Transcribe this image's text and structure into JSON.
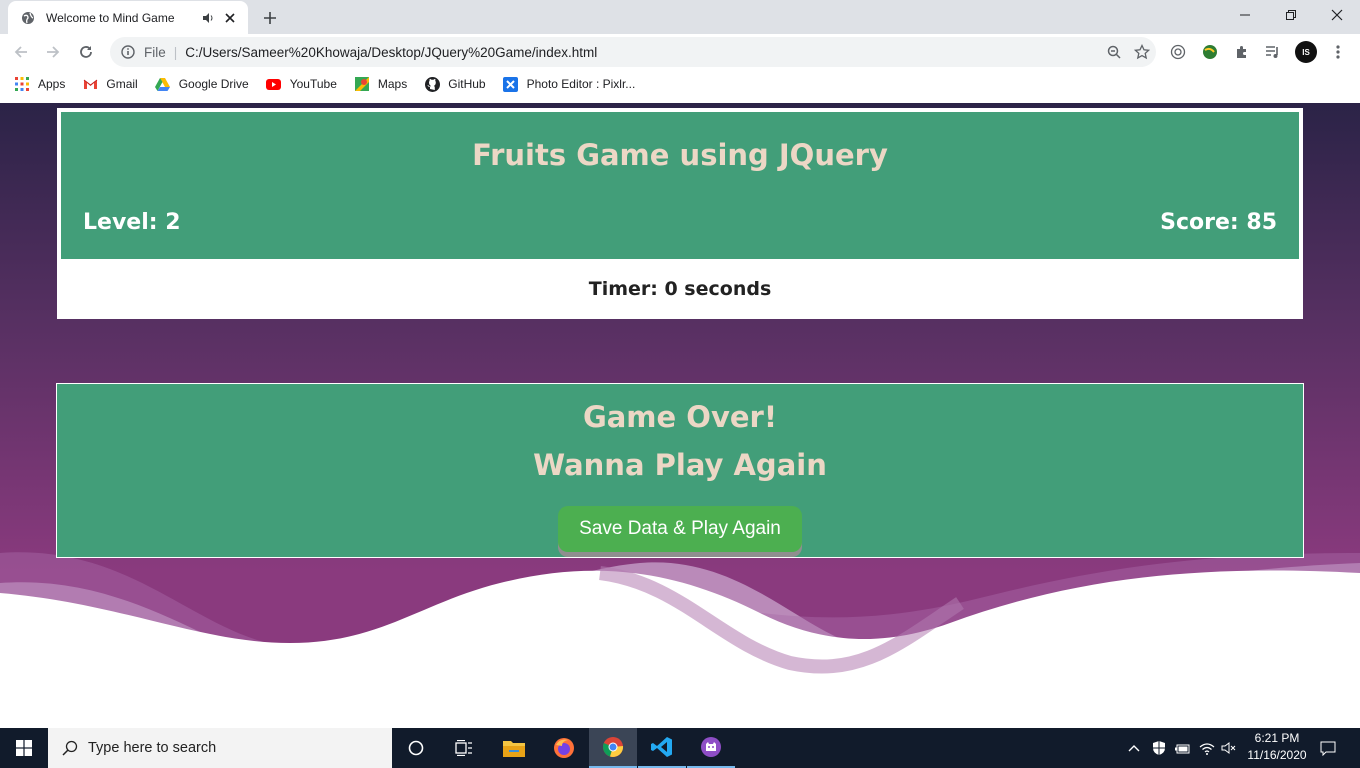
{
  "browser": {
    "tab_title": "Welcome to Mind Game",
    "url_scheme": "File",
    "url": "C:/Users/Sameer%20Khowaja/Desktop/JQuery%20Game/index.html",
    "bookmarks": [
      "Apps",
      "Gmail",
      "Google Drive",
      "YouTube",
      "Maps",
      "GitHub",
      "Photo Editor : Pixlr..."
    ],
    "profile_initials": "IS"
  },
  "game": {
    "title": "Fruits Game using JQuery",
    "level_label": "Level: 2",
    "score_label": "Score: 85",
    "timer_label": "Timer: 0 seconds",
    "game_over": "Game Over!",
    "play_again_prompt": "Wanna Play Again",
    "button_label": "Save Data & Play Again"
  },
  "taskbar": {
    "search_placeholder": "Type here to search",
    "time": "6:21 PM",
    "date": "11/16/2020"
  },
  "colors": {
    "panel_green": "#429e79",
    "button_green": "#4caf50",
    "title_cream": "#ecd7c5",
    "bg_top": "#2b2347",
    "bg_bottom": "#8a3a7e"
  }
}
